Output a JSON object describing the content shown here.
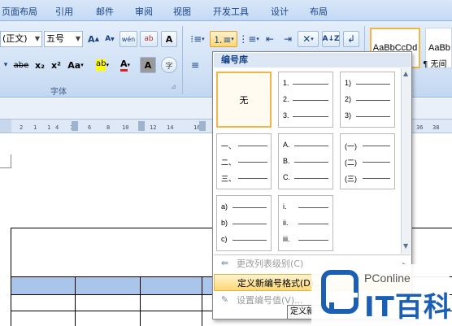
{
  "tabs": [
    "页面布局",
    "引用",
    "邮件",
    "审阅",
    "视图",
    "开发工具",
    "设计",
    "布局"
  ],
  "font": {
    "name": "(正文)",
    "size": "五号",
    "group_label": "字体",
    "buttons": {
      "grow": "A",
      "shrink": "A",
      "pinyin": "wén",
      "clear": "ab",
      "border": "A",
      "strike": "abe",
      "subscript": "x₂",
      "superscript": "x²",
      "case": "Aa",
      "highlight": "ab",
      "color": "A",
      "shade": "A",
      "enclose": "字"
    }
  },
  "styles": {
    "tile1": "AaBbCcDd",
    "tile2": "AaBb",
    "tile3": "¶ 无间"
  },
  "ruler_ticks": [
    "2",
    "1",
    "1",
    "4",
    "1",
    "6",
    "8",
    "10",
    "12",
    "14",
    "16",
    "36",
    "38"
  ],
  "dropdown": {
    "header": "编号库",
    "formats": [
      {
        "kind": "none",
        "label": "无"
      },
      {
        "kind": "list",
        "items": [
          "1.",
          "2.",
          "3."
        ]
      },
      {
        "kind": "list",
        "items": [
          "1)",
          "2)",
          "3)"
        ]
      },
      {
        "kind": "list",
        "items": [
          "一、",
          "二、",
          "三、"
        ]
      },
      {
        "kind": "list",
        "items": [
          "A.",
          "B.",
          "C."
        ]
      },
      {
        "kind": "list",
        "items": [
          "(一)",
          "(二)",
          "(三)"
        ]
      },
      {
        "kind": "list",
        "items": [
          "a)",
          "b)",
          "c)"
        ]
      },
      {
        "kind": "list",
        "items": [
          "i.",
          "ii.",
          "iii."
        ]
      }
    ],
    "menu": {
      "change_level": "更改列表级别(C)",
      "define_new": "定义新编号格式(D)...",
      "set_value": "设置编号值(V)..."
    }
  },
  "tooltip": "定义新",
  "watermark": {
    "brand_top": "PConline",
    "brand_bottom": "IT百科"
  },
  "colors": {
    "selected_border": "#f0b64c",
    "hover_fill": "#ffd875",
    "table_header": "#a9c6ea",
    "brand_blue": "#1a5fb4"
  }
}
